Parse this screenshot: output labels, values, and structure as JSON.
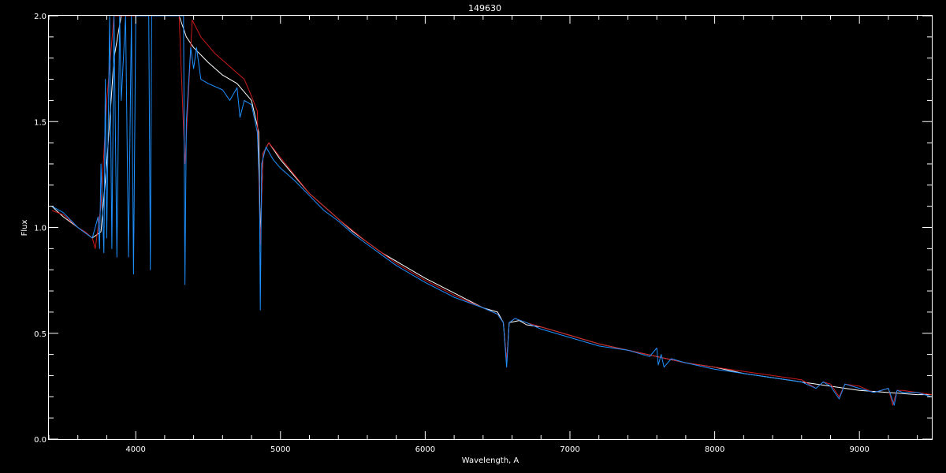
{
  "chart_data": {
    "type": "line",
    "title": "149630",
    "xlabel": "Wavelength, A",
    "ylabel": "Flux",
    "xlim": [
      3400,
      9500
    ],
    "ylim": [
      0.0,
      2.0
    ],
    "x_ticks": [
      4000,
      5000,
      6000,
      7000,
      8000,
      9000
    ],
    "x_tick_labels": [
      "4000",
      "5000",
      "6000",
      "7000",
      "8000",
      "9000"
    ],
    "y_ticks": [
      0.0,
      0.5,
      1.0,
      1.5,
      2.0
    ],
    "y_tick_labels": [
      "0.0",
      "0.5",
      "1.0",
      "1.5",
      "2.0"
    ],
    "grid": false,
    "background": "#000000",
    "series": [
      {
        "color": "#ffffff",
        "x": [
          3420,
          3500,
          3600,
          3700,
          3760,
          3800,
          3850,
          3900,
          4000,
          4100,
          4200,
          4300,
          4350,
          4400,
          4500,
          4600,
          4700,
          4800,
          4850,
          4861,
          4880,
          4920,
          5000,
          5100,
          5200,
          5300,
          5400,
          5500,
          5700,
          6000,
          6200,
          6400,
          6500,
          6540,
          6563,
          6580,
          6650,
          6700,
          6800,
          7000,
          7200,
          7400,
          7600,
          7800,
          8000,
          8200,
          8400,
          8600,
          8800,
          9000,
          9200,
          9400,
          9500
        ],
        "y": [
          1.1,
          1.05,
          1.0,
          0.95,
          0.98,
          1.3,
          1.8,
          2.0,
          2.0,
          2.0,
          2.0,
          2.0,
          1.9,
          1.85,
          1.78,
          1.72,
          1.68,
          1.6,
          1.45,
          0.95,
          1.35,
          1.4,
          1.32,
          1.24,
          1.16,
          1.1,
          1.04,
          0.98,
          0.88,
          0.76,
          0.69,
          0.62,
          0.6,
          0.55,
          0.36,
          0.55,
          0.56,
          0.54,
          0.53,
          0.49,
          0.45,
          0.42,
          0.39,
          0.36,
          0.34,
          0.31,
          0.29,
          0.27,
          0.25,
          0.23,
          0.22,
          0.21,
          0.21
        ]
      },
      {
        "color": "#cc1a1a",
        "x": [
          3420,
          3500,
          3600,
          3650,
          3700,
          3720,
          3760,
          3800,
          3850,
          3900,
          3970,
          3990,
          4050,
          4101,
          4150,
          4250,
          4300,
          4340,
          4390,
          4450,
          4550,
          4650,
          4750,
          4800,
          4840,
          4861,
          4880,
          4920,
          5000,
          5200,
          5400,
          5600,
          5800,
          6000,
          6200,
          6400,
          6500,
          6540,
          6563,
          6580,
          6620,
          6700,
          6800,
          7000,
          7200,
          7400,
          7600,
          7800,
          8000,
          8200,
          8400,
          8600,
          8700,
          8750,
          8800,
          8860,
          8900,
          9000,
          9100,
          9200,
          9230,
          9260,
          9300,
          9400,
          9500
        ],
        "y": [
          1.08,
          1.06,
          1.0,
          0.98,
          0.95,
          0.9,
          1.1,
          1.6,
          2.0,
          2.0,
          2.0,
          2.0,
          2.0,
          2.0,
          2.0,
          2.0,
          2.0,
          1.3,
          1.98,
          1.9,
          1.82,
          1.76,
          1.7,
          1.62,
          1.55,
          0.92,
          1.35,
          1.4,
          1.33,
          1.16,
          1.04,
          0.93,
          0.83,
          0.75,
          0.68,
          0.62,
          0.59,
          0.55,
          0.37,
          0.55,
          0.57,
          0.55,
          0.53,
          0.49,
          0.45,
          0.42,
          0.39,
          0.36,
          0.34,
          0.32,
          0.3,
          0.28,
          0.24,
          0.27,
          0.26,
          0.2,
          0.26,
          0.25,
          0.22,
          0.24,
          0.16,
          0.23,
          0.23,
          0.22,
          0.21
        ]
      },
      {
        "color": "#1e90ff",
        "x": [
          3420,
          3500,
          3600,
          3700,
          3740,
          3750,
          3760,
          3780,
          3790,
          3800,
          3820,
          3835,
          3850,
          3870,
          3889,
          3900,
          3930,
          3950,
          3970,
          3985,
          4000,
          4050,
          4090,
          4101,
          4110,
          4200,
          4300,
          4330,
          4340,
          4350,
          4380,
          4400,
          4420,
          4450,
          4500,
          4600,
          4650,
          4700,
          4720,
          4750,
          4800,
          4840,
          4855,
          4861,
          4870,
          4900,
          4950,
          5000,
          5100,
          5200,
          5300,
          5400,
          5500,
          5600,
          5800,
          6000,
          6200,
          6400,
          6500,
          6540,
          6563,
          6580,
          6620,
          6700,
          6800,
          7000,
          7200,
          7400,
          7550,
          7600,
          7610,
          7630,
          7650,
          7700,
          7800,
          8000,
          8200,
          8400,
          8600,
          8700,
          8750,
          8800,
          8860,
          8900,
          9000,
          9100,
          9200,
          9240,
          9260,
          9300,
          9400,
          9500
        ],
        "y": [
          1.1,
          1.07,
          1.0,
          0.95,
          1.05,
          0.9,
          1.3,
          0.88,
          1.7,
          0.95,
          2.0,
          0.9,
          2.0,
          0.86,
          2.0,
          1.6,
          2.0,
          0.86,
          2.0,
          0.78,
          2.0,
          2.0,
          2.0,
          0.8,
          2.0,
          2.0,
          2.0,
          2.0,
          0.73,
          1.5,
          1.85,
          1.75,
          1.85,
          1.7,
          1.68,
          1.65,
          1.6,
          1.66,
          1.52,
          1.6,
          1.58,
          1.45,
          1.2,
          0.61,
          1.3,
          1.38,
          1.32,
          1.28,
          1.22,
          1.15,
          1.08,
          1.03,
          0.97,
          0.92,
          0.82,
          0.74,
          0.67,
          0.62,
          0.59,
          0.55,
          0.34,
          0.55,
          0.57,
          0.55,
          0.52,
          0.48,
          0.44,
          0.42,
          0.39,
          0.43,
          0.35,
          0.4,
          0.34,
          0.38,
          0.36,
          0.33,
          0.31,
          0.29,
          0.27,
          0.24,
          0.27,
          0.25,
          0.19,
          0.26,
          0.24,
          0.22,
          0.24,
          0.16,
          0.23,
          0.22,
          0.22,
          0.2
        ]
      }
    ]
  }
}
